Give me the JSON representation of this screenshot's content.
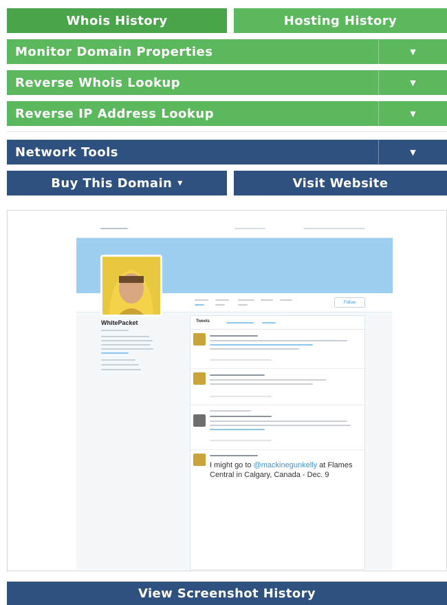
{
  "tabs": {
    "whois_history": "Whois History",
    "hosting_history": "Hosting History"
  },
  "accordions": [
    {
      "label": "Monitor Domain Properties"
    },
    {
      "label": "Reverse Whois Lookup"
    },
    {
      "label": "Reverse IP Address Lookup"
    },
    {
      "label": "Network Tools"
    }
  ],
  "actions": {
    "buy_domain": "Buy This Domain",
    "buy_caret": "▾",
    "visit_website": "Visit Website",
    "view_screenshot_history": "View Screenshot History"
  },
  "screenshot": {
    "profile_name": "WhitePacket",
    "timeline_tab": "Tweets",
    "follow_button": "Follow",
    "featured_tweet": "I might go to @mackinegunkelly at Flames Central in Calgary, Canada - Dec. 9",
    "featured_mention": "@mackinegunkelly"
  },
  "colors": {
    "green": "#5cb85c",
    "green_active": "#4aa54a",
    "blue": "#2e5180",
    "twitter_banner": "#9fcff0"
  },
  "icons": {
    "dropdown": "chevron-down-icon"
  }
}
